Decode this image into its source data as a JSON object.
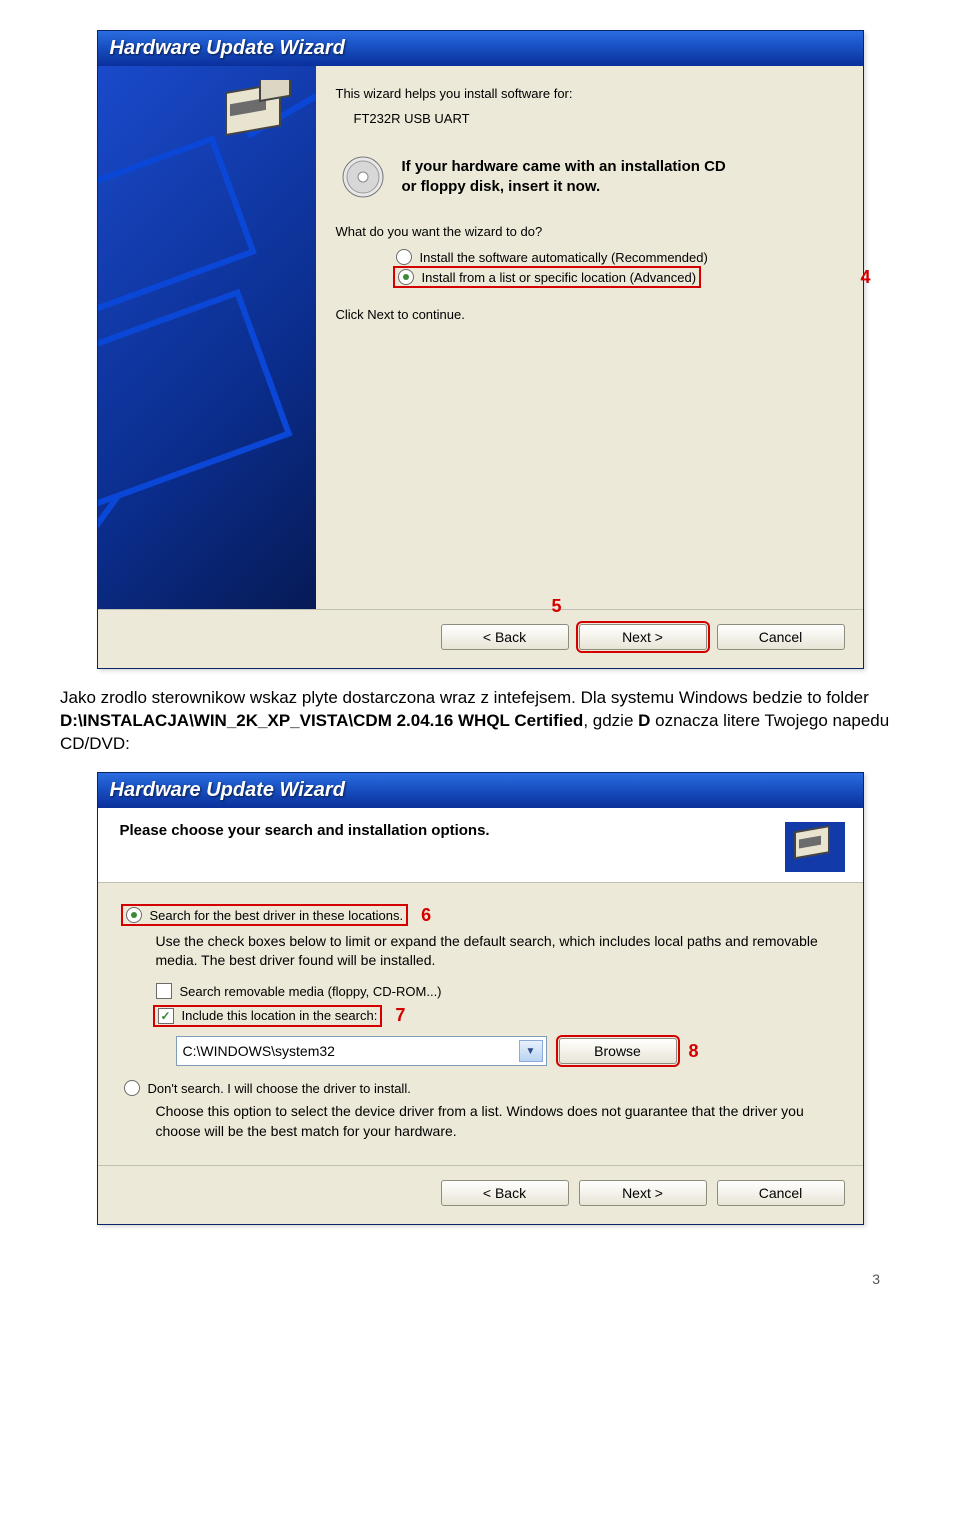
{
  "dialog1": {
    "title": "Hardware Update Wizard",
    "intro": "This wizard helps you install software for:",
    "device": "FT232R USB UART",
    "cd_line1": "If your hardware came with an installation CD",
    "cd_line2": "or floppy disk, insert it now.",
    "question": "What do you want the wizard to do?",
    "opt_auto": "Install the software automatically (Recommended)",
    "opt_advanced": "Install from a list or specific location (Advanced)",
    "click_next": "Click Next to continue.",
    "btn_back": "< Back",
    "btn_next": "Next >",
    "btn_cancel": "Cancel",
    "callout4": "4",
    "callout5": "5"
  },
  "mid_text": {
    "p1a": "Jako zrodlo sterownikow wskaz plyte dostarczona wraz z intefejsem. Dla systemu Windows bedzie to folder ",
    "p1b": "D:\\INSTALACJA\\WIN_2K_XP_VISTA\\CDM 2.04.16 WHQL Certified",
    "p1c": ", gdzie ",
    "p1d": "D",
    "p1e": " oznacza litere Twojego napedu CD/DVD:"
  },
  "dialog2": {
    "title": "Hardware Update Wizard",
    "header": "Please choose your search and installation options.",
    "opt_search": "Search for the best driver in these locations.",
    "search_desc": "Use the check boxes below to limit or expand the default search, which includes local paths and removable media. The best driver found will be installed.",
    "chk_removable": "Search removable media (floppy, CD-ROM...)",
    "chk_include": "Include this location in the search:",
    "combo_value": "C:\\WINDOWS\\system32",
    "btn_browse": "Browse",
    "opt_dont": "Don't search. I will choose the driver to install.",
    "dont_desc": "Choose this option to select the device driver from a list.  Windows does not guarantee that the driver you choose will be the best match for your hardware.",
    "btn_back": "< Back",
    "btn_next": "Next >",
    "btn_cancel": "Cancel",
    "callout6": "6",
    "callout7": "7",
    "callout8": "8"
  },
  "page_number": "3"
}
